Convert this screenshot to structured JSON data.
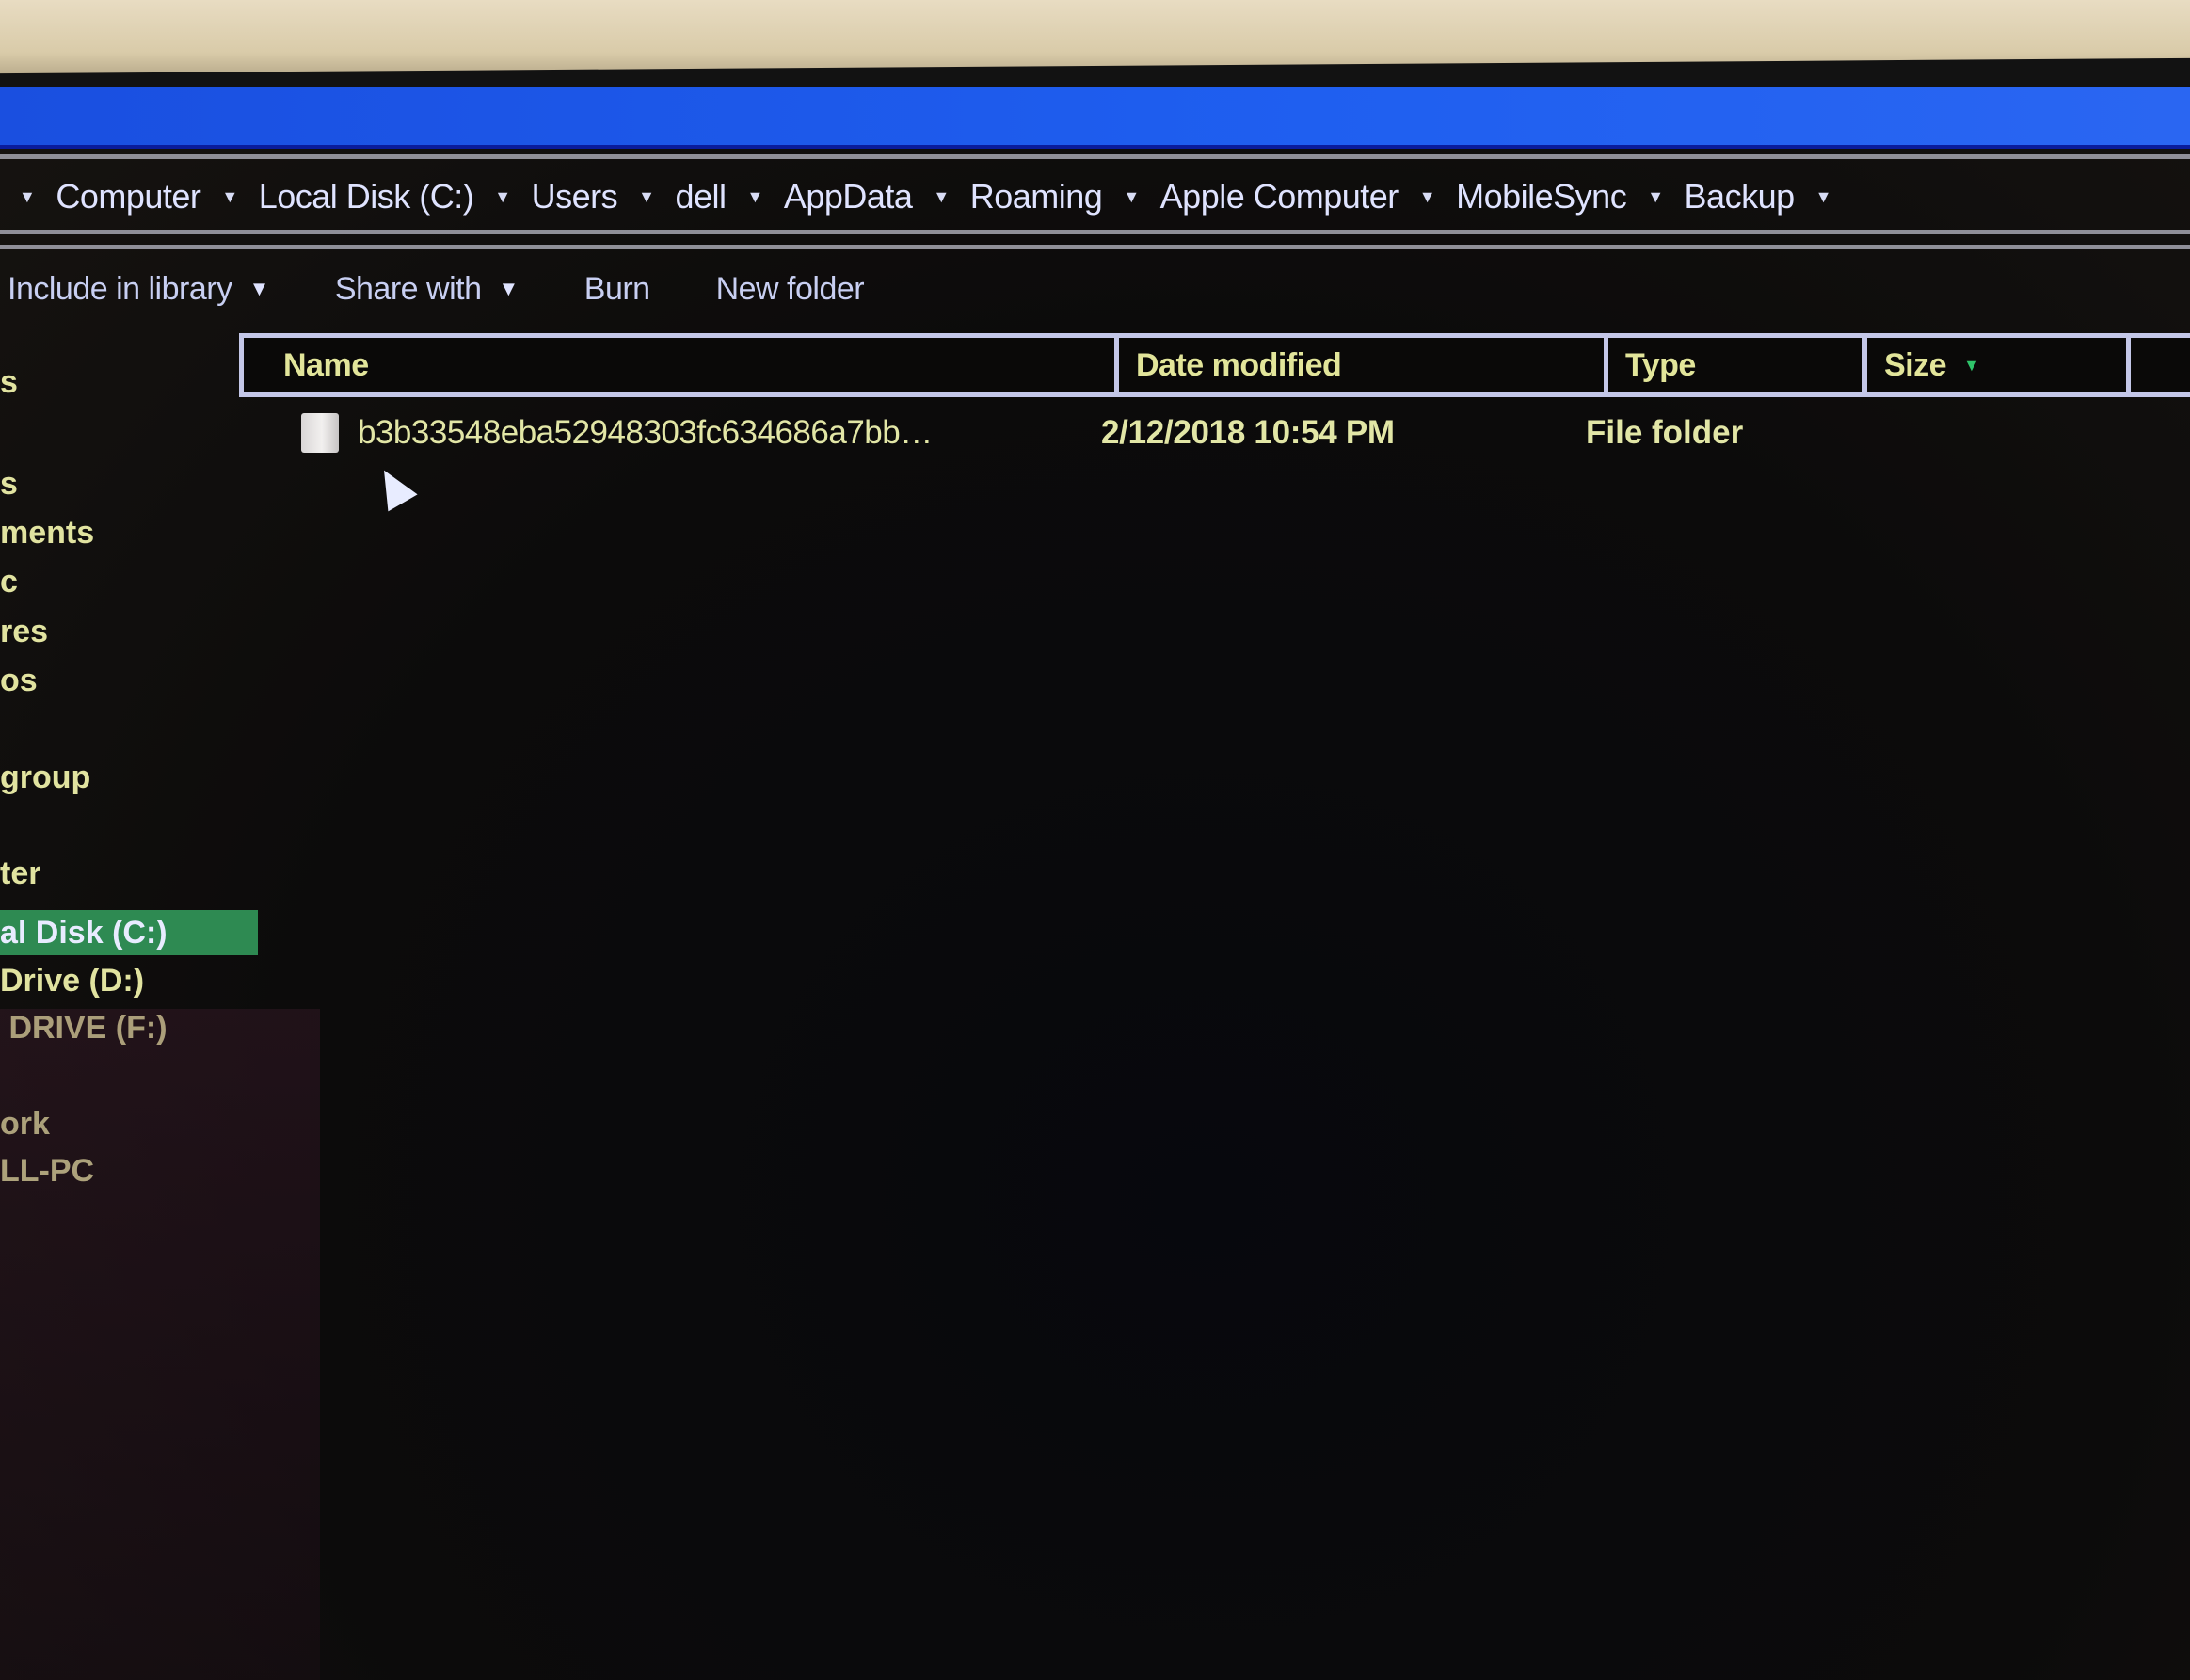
{
  "window": {
    "title_bar_color": "#1f5ff0"
  },
  "breadcrumb": {
    "items": [
      "Computer",
      "Local Disk (C:)",
      "Users",
      "dell",
      "AppData",
      "Roaming",
      "Apple Computer",
      "MobileSync",
      "Backup"
    ]
  },
  "toolbar": {
    "include_in_library": "Include in library",
    "share_with": "Share with",
    "burn": "Burn",
    "new_folder": "New folder",
    "dropdown_icon": "▼"
  },
  "columns": {
    "name": "Name",
    "date_modified": "Date modified",
    "type": "Type",
    "size": "Size",
    "sort_icon": "▼"
  },
  "files": [
    {
      "name": "b3b33548eba52948303fc634686a7bb…",
      "date_modified": "2/12/2018 10:54 PM",
      "type": "File folder",
      "size": ""
    }
  ],
  "sidebar": {
    "items": [
      {
        "label": "s"
      },
      {
        "label": "s"
      },
      {
        "label": "ments"
      },
      {
        "label": "c"
      },
      {
        "label": "res"
      },
      {
        "label": "os"
      },
      {
        "label": "group"
      },
      {
        "label": "ter"
      },
      {
        "label": "al Disk (C:)",
        "selected": true
      },
      {
        "label": "Drive (D:)"
      },
      {
        "label": " DRIVE (F:)"
      },
      {
        "label": "ork"
      },
      {
        "label": "LL-PC"
      }
    ],
    "selected_color": "#2e8a52"
  }
}
